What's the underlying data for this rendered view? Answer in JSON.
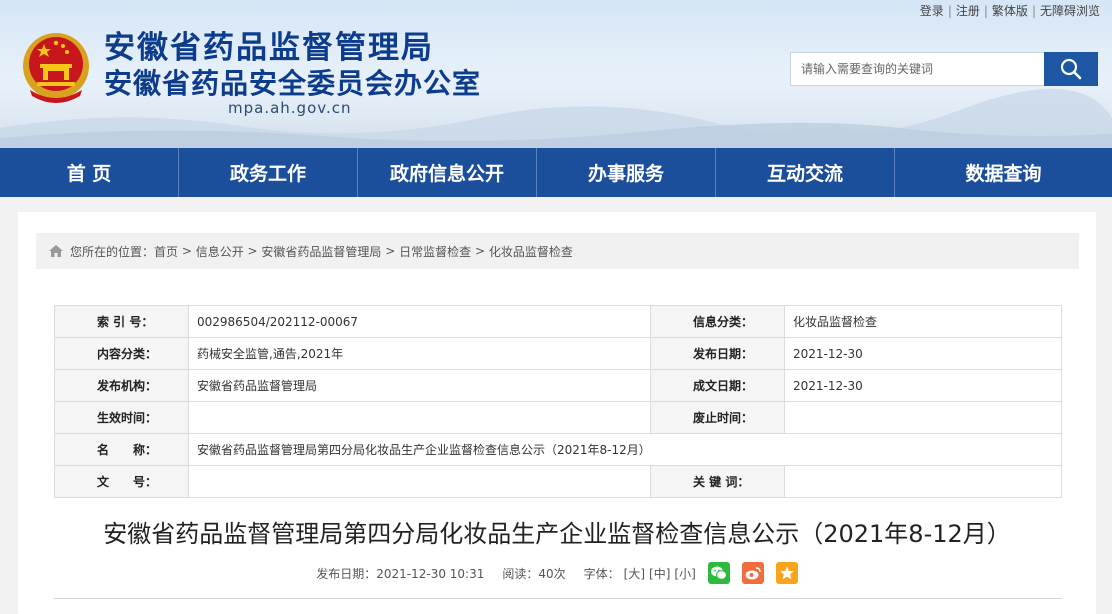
{
  "header": {
    "top_links": [
      "登录",
      "注册",
      "繁体版",
      "无障碍浏览"
    ],
    "title_main": "安徽省药品监督管理局",
    "title_sub": "安徽省药品安全委员会办公室",
    "domain": "mpa.ah.gov.cn",
    "search_placeholder": "请输入需要查询的关键词"
  },
  "nav": [
    "首 页",
    "政务工作",
    "政府信息公开",
    "办事服务",
    "互动交流",
    "数据查询"
  ],
  "breadcrumb": {
    "prefix": "您所在的位置：",
    "items": [
      "首页",
      "信息公开",
      "安徽省药品监督管理局",
      "日常监督检查",
      "化妆品监督检查"
    ],
    "separator": " > "
  },
  "meta": {
    "index_label": "索 引 号：",
    "index_value": "002986504/202112-00067",
    "category_label": "信息分类：",
    "category_value": "化妆品监督检查",
    "content_label": "内容分类：",
    "content_value": "药械安全监管,通告,2021年",
    "pubdate_label": "发布日期：",
    "pubdate_value": "2021-12-30",
    "org_label": "发布机构：",
    "org_value": "安徽省药品监督管理局",
    "docdate_label": "成文日期：",
    "docdate_value": "2021-12-30",
    "effective_label": "生效时间：",
    "effective_value": "",
    "expire_label": "废止时间：",
    "expire_value": "",
    "name_label": "名　　称：",
    "name_value": "安徽省药品监督管理局第四分局化妆品生产企业监督检查信息公示（2021年8-12月）",
    "docno_label": "文　　号：",
    "docno_value": "",
    "keyword_label": "关 键 词：",
    "keyword_value": ""
  },
  "article": {
    "title": "安徽省药品监督管理局第四分局化妆品生产企业监督检查信息公示（2021年8-12月）",
    "pub_label": "发布日期：2021-12-30 10:31",
    "views_label": "阅读：40次",
    "font_label": "字体：",
    "font_large": "[大]",
    "font_medium": "[中]",
    "font_small": "[小]"
  },
  "colors": {
    "brand_blue": "#1b4f9c",
    "title_blue": "#0d3c8c",
    "wechat_green": "#2dbb3f",
    "weibo_orange": "#f26d3d",
    "favorite_orange": "#f7a51d"
  },
  "icons": [
    "national-emblem-icon",
    "search-icon",
    "home-icon",
    "wechat-icon",
    "weibo-icon",
    "favorite-star-icon"
  ]
}
